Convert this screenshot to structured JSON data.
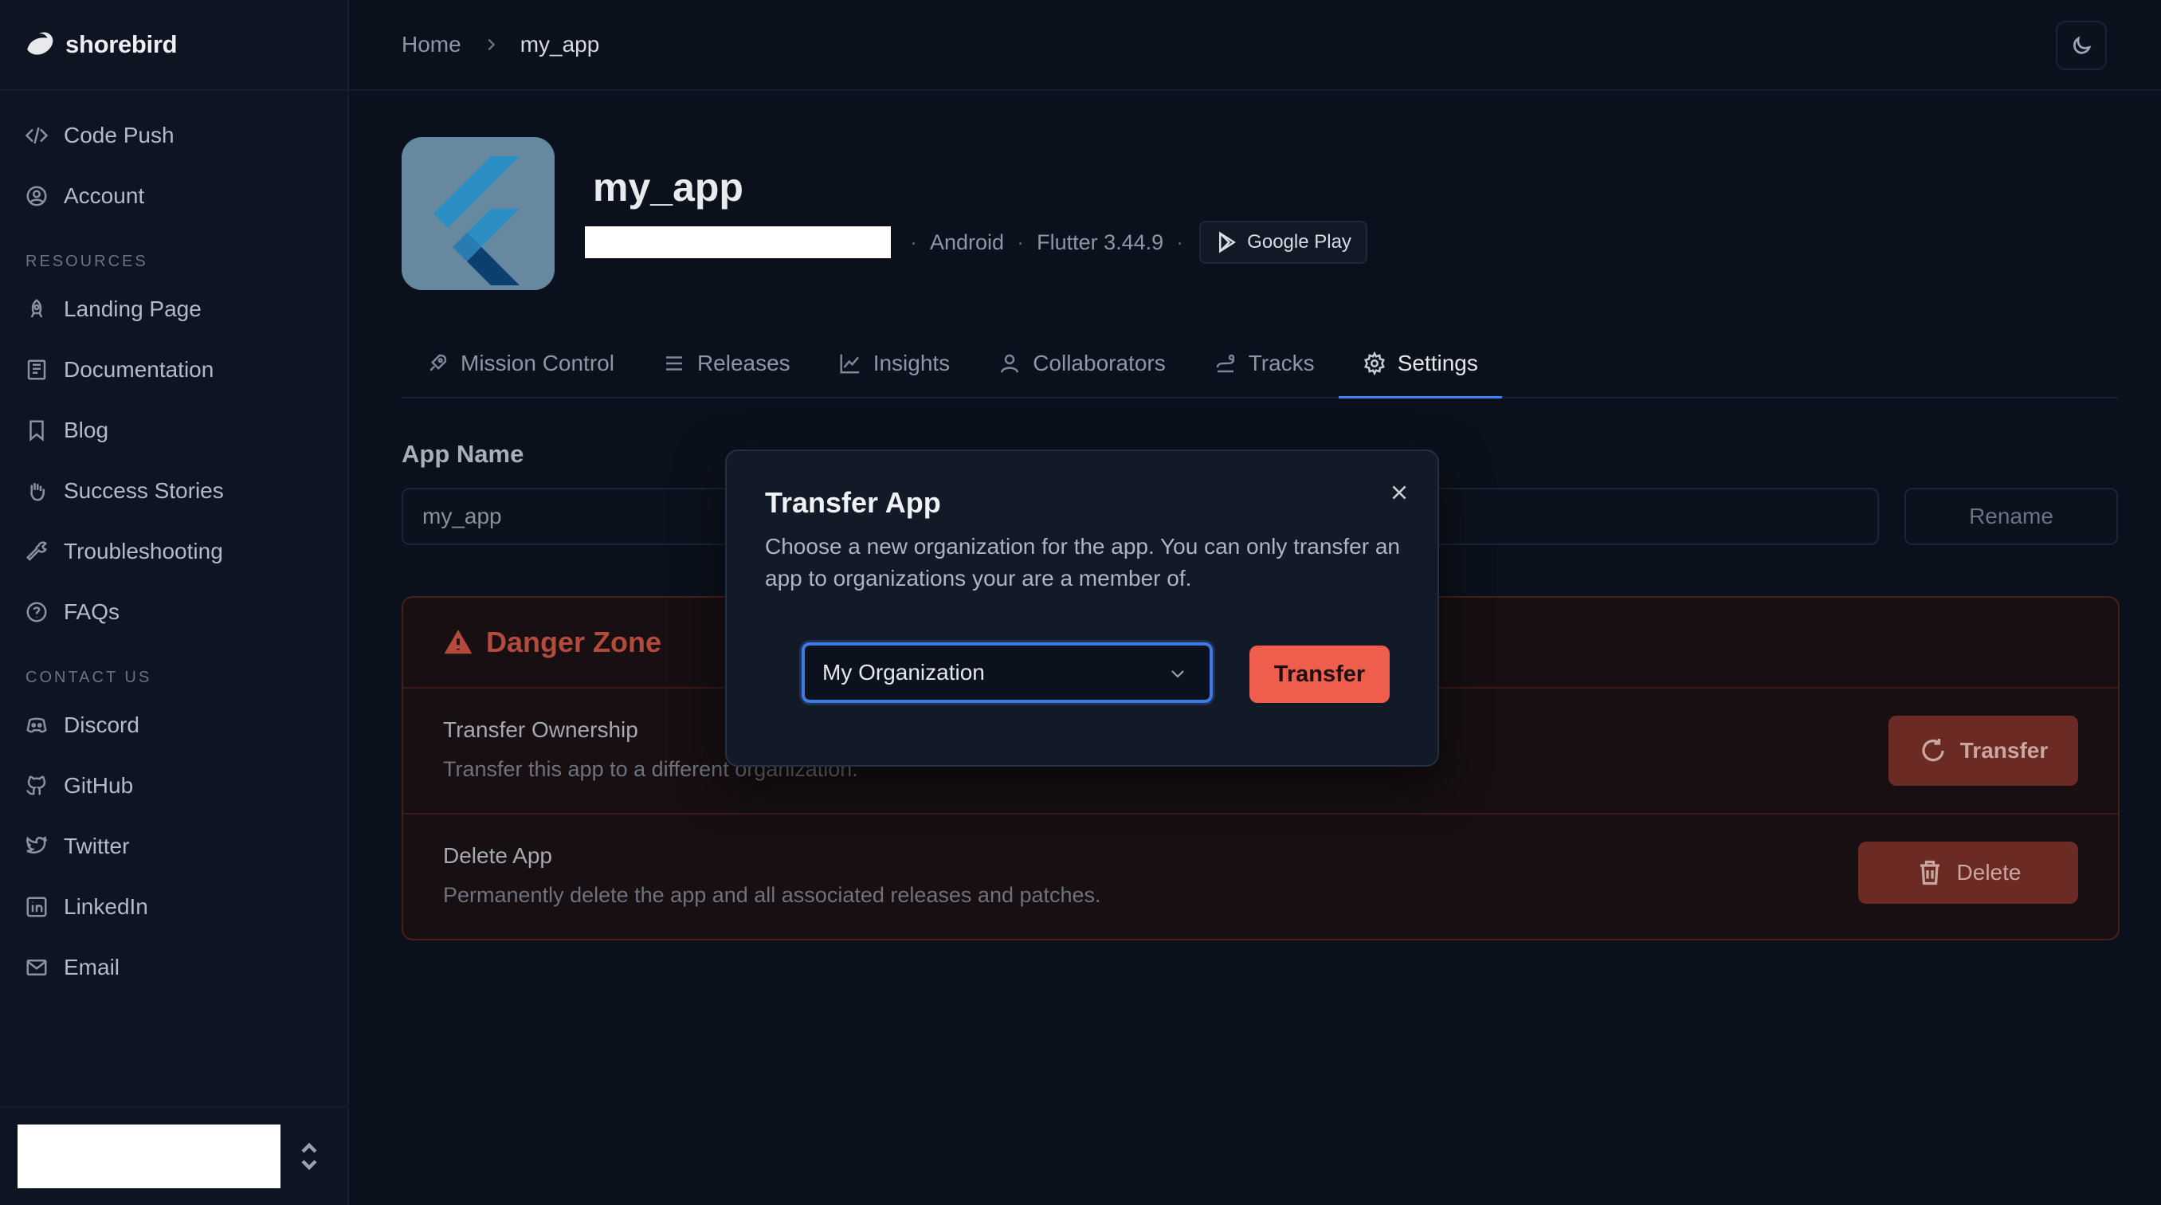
{
  "brand": {
    "name": "shorebird"
  },
  "sidebar": {
    "main_items": [
      {
        "label": "Code Push",
        "icon": "code-icon"
      },
      {
        "label": "Account",
        "icon": "account-icon"
      }
    ],
    "resources_label": "RESOURCES",
    "resources": [
      {
        "label": "Landing Page",
        "icon": "rocket-icon"
      },
      {
        "label": "Documentation",
        "icon": "book-icon"
      },
      {
        "label": "Blog",
        "icon": "bookmark-icon"
      },
      {
        "label": "Success Stories",
        "icon": "hand-icon"
      },
      {
        "label": "Troubleshooting",
        "icon": "wrench-icon"
      },
      {
        "label": "FAQs",
        "icon": "help-icon"
      }
    ],
    "contact_label": "CONTACT US",
    "contact": [
      {
        "label": "Discord",
        "icon": "discord-icon"
      },
      {
        "label": "GitHub",
        "icon": "github-icon"
      },
      {
        "label": "Twitter",
        "icon": "twitter-icon"
      },
      {
        "label": "LinkedIn",
        "icon": "linkedin-icon"
      },
      {
        "label": "Email",
        "icon": "mail-icon"
      }
    ]
  },
  "header": {
    "breadcrumb_home": "Home",
    "breadcrumb_current": "my_app"
  },
  "app": {
    "title": "my_app",
    "platform": "Android",
    "flutter_version": "Flutter 3.44.9",
    "store_label": "Google Play"
  },
  "tabs": [
    {
      "label": "Mission Control",
      "active": false
    },
    {
      "label": "Releases",
      "active": false
    },
    {
      "label": "Insights",
      "active": false
    },
    {
      "label": "Collaborators",
      "active": false
    },
    {
      "label": "Tracks",
      "active": false
    },
    {
      "label": "Settings",
      "active": true
    }
  ],
  "settings": {
    "app_name_label": "App Name",
    "app_name_value": "my_app",
    "rename_label": "Rename",
    "danger_zone_title": "Danger Zone",
    "transfer_title": "Transfer Ownership",
    "transfer_desc": "Transfer this app to a different organization.",
    "transfer_button": "Transfer",
    "delete_title": "Delete App",
    "delete_desc": "Permanently delete the app and all associated releases and patches.",
    "delete_button": "Delete"
  },
  "modal": {
    "title": "Transfer App",
    "description": "Choose a new organization for the app. You can only transfer an app to organizations your are a member of.",
    "selected_org": "My Organization",
    "transfer_button": "Transfer"
  },
  "colors": {
    "accent_blue": "#3b82f6",
    "transfer_button": "#ef5d4c",
    "danger_text": "#b34a3c"
  }
}
